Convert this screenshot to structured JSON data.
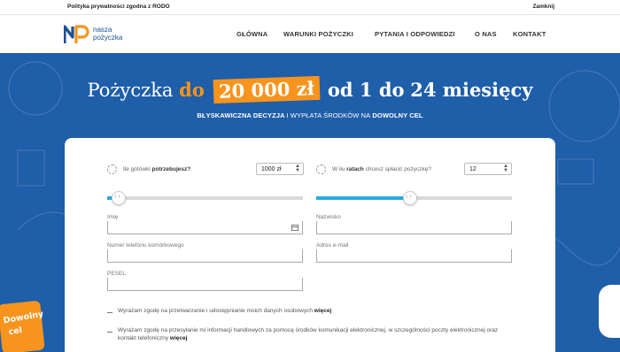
{
  "topbar": {
    "policy_link": "Polityka prywatności zgodna z RODO",
    "close_link": "Zamknij"
  },
  "brand": {
    "line1": "nasza",
    "line2": "pożyczka",
    "mark": "NP"
  },
  "nav": {
    "items": [
      "GŁÓWNA",
      "WARUNKI POŻYCZKI",
      "PYTANIA I ODPOWIEDZI",
      "O NAS",
      "KONTAKT"
    ]
  },
  "hero": {
    "prefix": "Pożyczka",
    "do": "do",
    "amount": "20 000 zł",
    "period_prefix": "od 1 do",
    "period_value": "24 miesięcy",
    "sub_bold1": "BŁYSKAWICZNA DECYZJA",
    "sub_mid": "I WYPŁATA ŚRODKÓW NA",
    "sub_bold2": "DOWOLNY CEL"
  },
  "form": {
    "amount_question_prefix": "Ile gotówki",
    "amount_question_bold": "potrzebujesz?",
    "amount_value": "1000 zł",
    "amount_slider_fraction": 0.06,
    "installments_question_prefix": "W ilu",
    "installments_question_bold": "ratach",
    "installments_question_suffix": "chcesz spłacić pożyczkę?",
    "installments_value": "12",
    "installments_slider_fraction": 0.48,
    "fields": {
      "first_name": "Imię",
      "last_name": "Nazwisko",
      "phone": "Numer telefonu komórkowego",
      "email": "Adres e-mail",
      "pesel": "PESEL"
    },
    "consent1_text": "Wyrażam zgodę na przetwarzanie i udostępnianie moich danych osobowych",
    "consent1_more": "więcej",
    "consent2_line1": "Wyrażam zgodę na przesyłanie mi informacji handlowych za pomocą środków komunikacji elektronicznej, w szczególności poczty elektronicznej",
    "consent2_line2": "oraz kontakt telefoniczny",
    "consent2_more": "więcej"
  },
  "sticker": {
    "line1": "Dowolny",
    "line2": "cel"
  },
  "colors": {
    "hero_blue": "#1f5ea9",
    "accent_orange": "#f7941d",
    "slider_blue": "#29abe2"
  }
}
